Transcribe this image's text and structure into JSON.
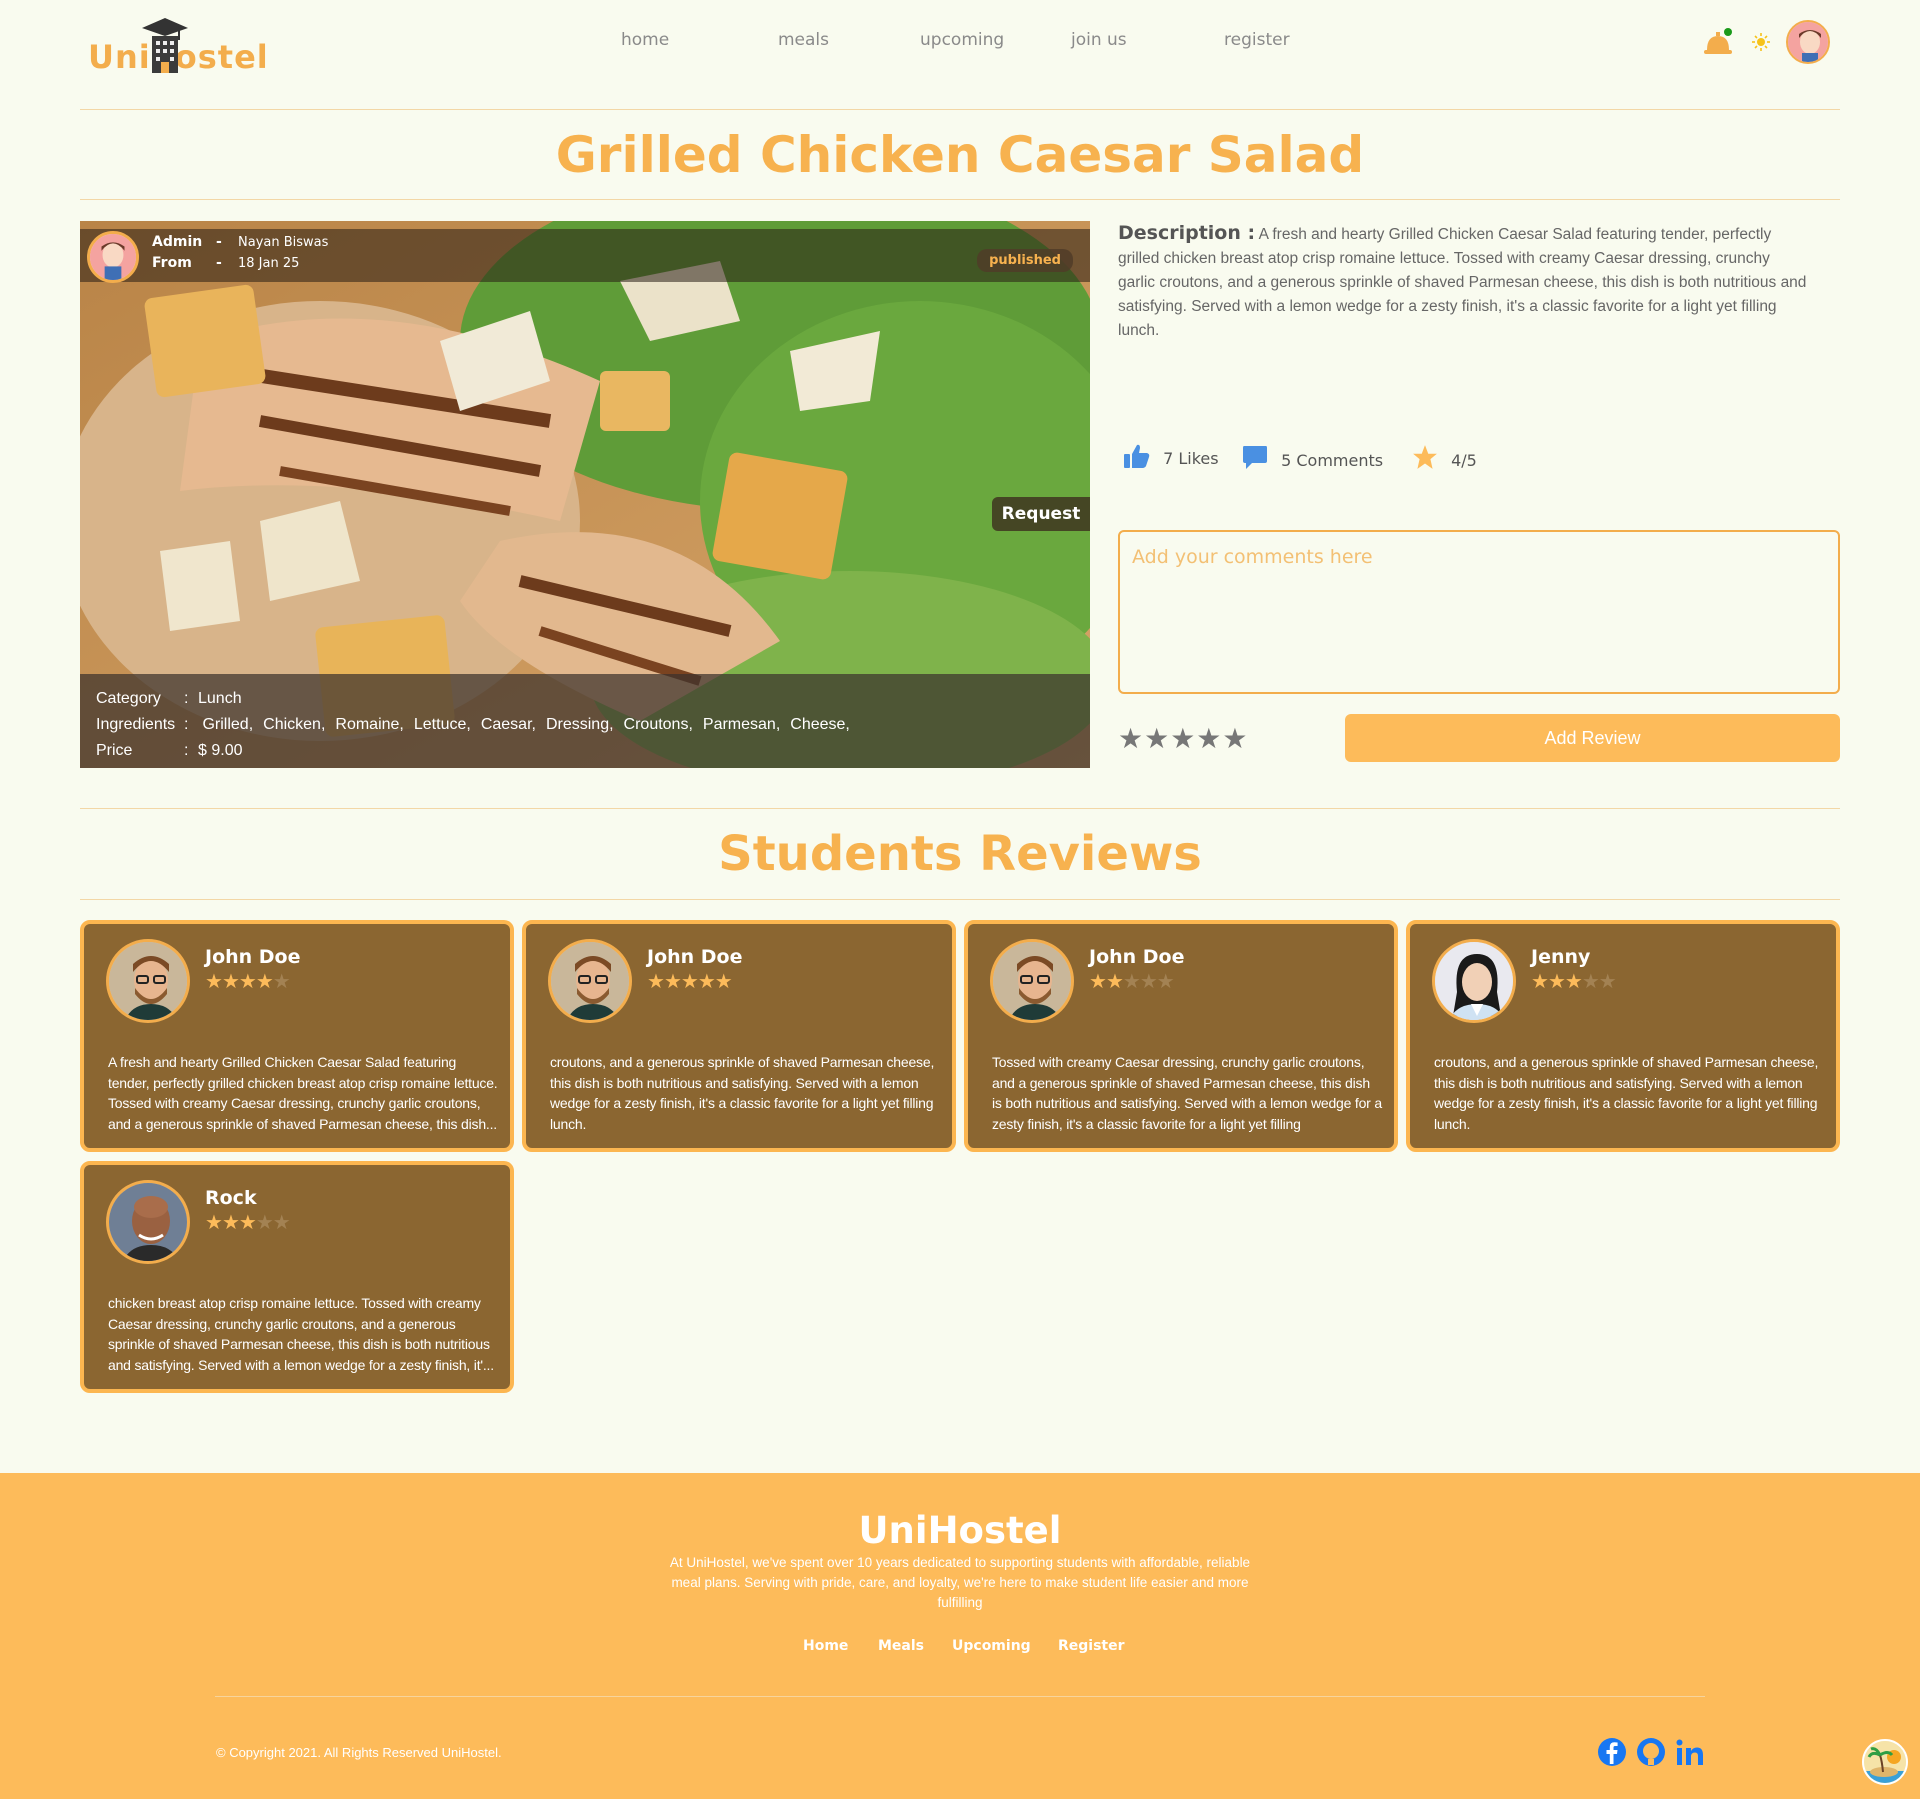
{
  "brand": {
    "name_part1": "Uni",
    "name_part2": "ostel"
  },
  "nav": [
    "home",
    "meals",
    "upcoming",
    "join us",
    "register"
  ],
  "meal": {
    "title": "Grilled Chicken Caesar Salad",
    "admin_label": "Admin",
    "admin_sep": "-",
    "admin_name": "Nayan Biswas",
    "from_label": "From",
    "from_sep": "-",
    "from_date": "18 Jan 25",
    "status": "published",
    "request_label": "Request",
    "category_label": "Category",
    "category": "Lunch",
    "ingredients_label": "Ingredients",
    "ingredients": [
      "Grilled,",
      "Chicken,",
      "Romaine,",
      "Lettuce,",
      "Caesar,",
      "Dressing,",
      "Croutons,",
      "Parmesan,",
      "Cheese,"
    ],
    "price_label": "Price",
    "price": "$ 9.00",
    "colon": ":",
    "description_label": "Description :",
    "description": "A fresh and hearty Grilled Chicken Caesar Salad featuring tender, perfectly grilled chicken breast atop crisp romaine lettuce. Tossed with creamy Caesar dressing, crunchy garlic croutons, and a generous sprinkle of shaved Parmesan cheese, this dish is both nutritious and satisfying. Served with a lemon wedge for a zesty finish, it's a classic favorite for a light yet filling lunch.",
    "likes": "7 Likes",
    "comments": "5 Comments",
    "rating": "4/5"
  },
  "review_form": {
    "placeholder": "Add your comments here",
    "stars": "★★★★★",
    "submit_label": "Add Review"
  },
  "reviews_title": "Students Reviews",
  "reviews": [
    {
      "name": "John Doe",
      "rating": 4,
      "avatar": "male-glasses",
      "text": "A fresh and hearty Grilled Chicken Caesar Salad featuring tender, perfectly grilled chicken breast atop crisp romaine lettuce. Tossed with creamy Caesar dressing, crunchy garlic croutons, and a generous sprinkle of shaved Parmesan cheese, this dish..."
    },
    {
      "name": "John Doe",
      "rating": 5,
      "avatar": "male-glasses",
      "text": "croutons, and a generous sprinkle of shaved Parmesan cheese, this dish is both nutritious and satisfying. Served with a lemon wedge for a zesty finish, it's a classic favorite for a light yet filling lunch."
    },
    {
      "name": "John Doe",
      "rating": 2,
      "avatar": "male-glasses",
      "text": "Tossed with creamy Caesar dressing, crunchy garlic croutons, and a generous sprinkle of shaved Parmesan cheese, this dish is both nutritious and satisfying. Served with a lemon wedge for a zesty finish, it's a classic favorite for a light yet filling"
    },
    {
      "name": "Jenny",
      "rating": 3,
      "avatar": "female",
      "text": "croutons, and a generous sprinkle of shaved Parmesan cheese, this dish is both nutritious and satisfying. Served with a lemon wedge for a zesty finish, it's a classic favorite for a light yet filling lunch."
    },
    {
      "name": "Rock",
      "rating": 3,
      "avatar": "male-bald",
      "text": "chicken breast atop crisp romaine lettuce. Tossed with creamy Caesar dressing, crunchy garlic croutons, and a generous sprinkle of shaved Parmesan cheese, this dish is both nutritious and satisfying. Served with a lemon wedge for a zesty finish, it'..."
    }
  ],
  "footer": {
    "brand": "UniHostel",
    "about": "At UniHostel, we've spent over 10 years dedicated to supporting students with affordable, reliable meal plans. Serving with pride, care, and loyalty, we're here to make student life easier and more fulfilling",
    "links": [
      "Home",
      "Meals",
      "Upcoming",
      "Register"
    ],
    "copyright": "© Copyright 2021. All Rights Reserved UniHostel."
  },
  "colors": {
    "accent": "#fdbb5a",
    "title": "#f7b24f",
    "card": "#8b6631",
    "background": "#f9fbef"
  },
  "icons": [
    "building-icon",
    "bell-icon",
    "sun-icon",
    "thumbs-up-icon",
    "comment-icon",
    "star-icon",
    "facebook-icon",
    "github-icon",
    "linkedin-icon"
  ]
}
